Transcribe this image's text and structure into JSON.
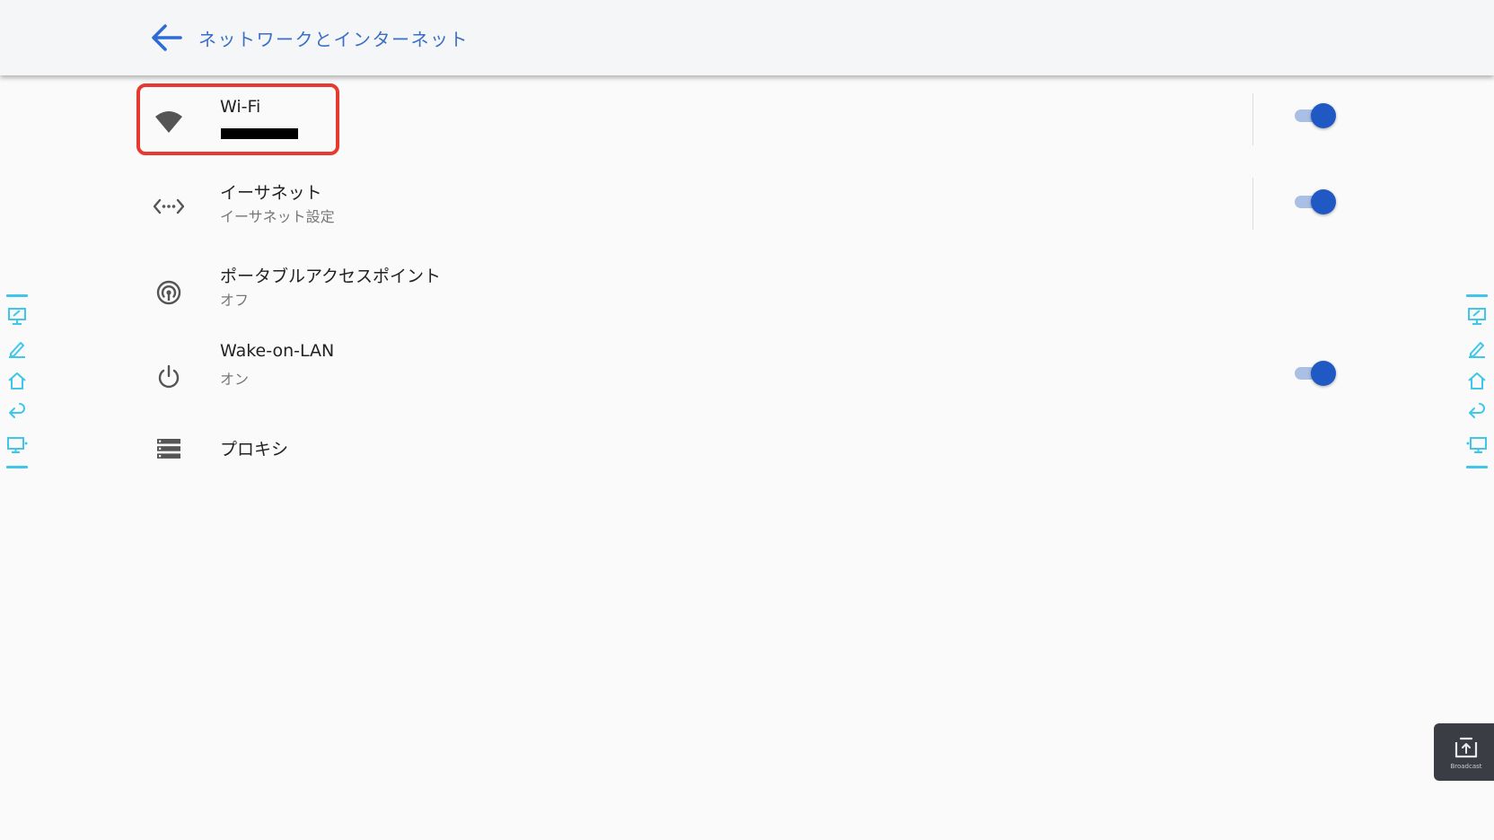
{
  "header": {
    "title": "ネットワークとインターネット"
  },
  "rows": [
    {
      "title": "Wi-Fi",
      "subtitle": "",
      "icon": "wifi-icon",
      "toggle": true,
      "toggle_on": true
    },
    {
      "title": "イーサネット",
      "subtitle": "イーサネット設定",
      "icon": "ethernet-icon",
      "toggle": true,
      "toggle_on": true
    },
    {
      "title": "ポータブルアクセスポイント",
      "subtitle": "オフ",
      "icon": "hotspot-icon",
      "toggle": false
    },
    {
      "title": "Wake-on-LAN",
      "subtitle": "オン",
      "icon": "power-icon",
      "toggle": true,
      "toggle_on": true
    },
    {
      "title": "プロキシ",
      "icon": "proxy-icon",
      "toggle": false
    }
  ],
  "side_dock": {
    "tools": [
      "whiteboard-icon",
      "pen-icon",
      "home-icon",
      "back-icon",
      "pc-icon"
    ]
  },
  "broadcast": {
    "label": "Broadcast",
    "icon": "broadcast-icon"
  },
  "colors": {
    "accent": "#3a6fc7",
    "toggle_thumb": "#2159c4",
    "toggle_track": "#a9bfe6",
    "highlight": "#e63a30",
    "dock": "#3ec7ea"
  }
}
